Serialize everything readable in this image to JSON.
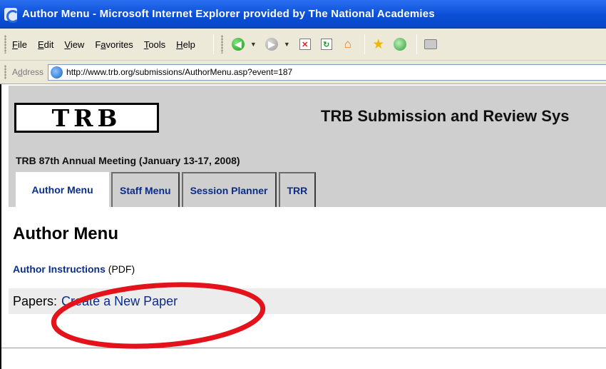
{
  "window": {
    "title": "Author Menu - Microsoft Internet Explorer provided by The National Academies"
  },
  "menu": {
    "items": [
      {
        "pre": "",
        "u": "F",
        "post": "ile"
      },
      {
        "pre": "",
        "u": "E",
        "post": "dit"
      },
      {
        "pre": "",
        "u": "V",
        "post": "iew"
      },
      {
        "pre": "F",
        "u": "a",
        "post": "vorites"
      },
      {
        "pre": "",
        "u": "T",
        "post": "ools"
      },
      {
        "pre": "",
        "u": "H",
        "post": "elp"
      }
    ]
  },
  "toolbar": {
    "back_icon": "back-arrow-icon",
    "forward_icon": "forward-arrow-icon",
    "stop_icon": "stop-icon",
    "refresh_icon": "refresh-icon",
    "home_icon": "home-icon",
    "favorites_icon": "star-icon",
    "history_icon": "history-icon",
    "print_icon": "print-icon"
  },
  "address": {
    "label_pre": "A",
    "label_u": "d",
    "label_post": "dress",
    "url": "http://www.trb.org/submissions/AuthorMenu.asp?event=187"
  },
  "page": {
    "logo_text": "TRB",
    "system_title": "TRB Submission and Review Sys",
    "meeting": "TRB 87th Annual Meeting (January 13-17, 2008)",
    "tabs": [
      "Author Menu",
      "Staff Menu",
      "Session Planner",
      "TRR"
    ],
    "heading": "Author Menu",
    "instructions_link": "Author Instructions",
    "instructions_suffix": " (PDF)",
    "papers_label": "Papers:",
    "create_paper_link": "Create a New Paper"
  },
  "colors": {
    "link": "#0b2d8a",
    "title_bar": "#0a4fd6",
    "highlight": "#e3121b"
  }
}
